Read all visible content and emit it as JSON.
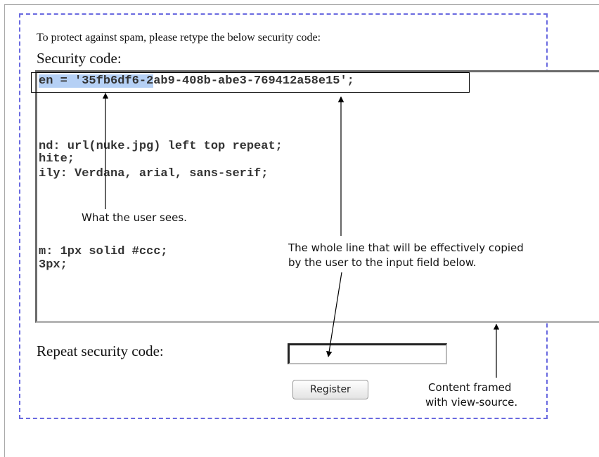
{
  "form": {
    "intro_text": "To protect against spam, please retype the below security code:",
    "code_title": "Security code:",
    "repeat_label": "Repeat security code:",
    "input_value": "",
    "register_label": "Register"
  },
  "source_view": {
    "first_line_highlighted": "en = '35fb6df6-2",
    "first_line_rest": "ab9-408b-abe3-769412a58e15';",
    "lines": [
      "nd: url(nuke.jpg) left top repeat;",
      "hite;",
      "ily: Verdana, arial, sans-serif;",
      "m: 1px solid #ccc;",
      "3px;"
    ]
  },
  "annotations": {
    "user_sees": "What the user sees.",
    "whole_line_1": "The whole line that will be effectively copied",
    "whole_line_2": "by the user to the input field below.",
    "framed_1": "Content framed",
    "framed_2": "with view-source."
  },
  "colors": {
    "selection_highlight": "#b5d0f5",
    "dashed_border": "#6a6ae0"
  }
}
